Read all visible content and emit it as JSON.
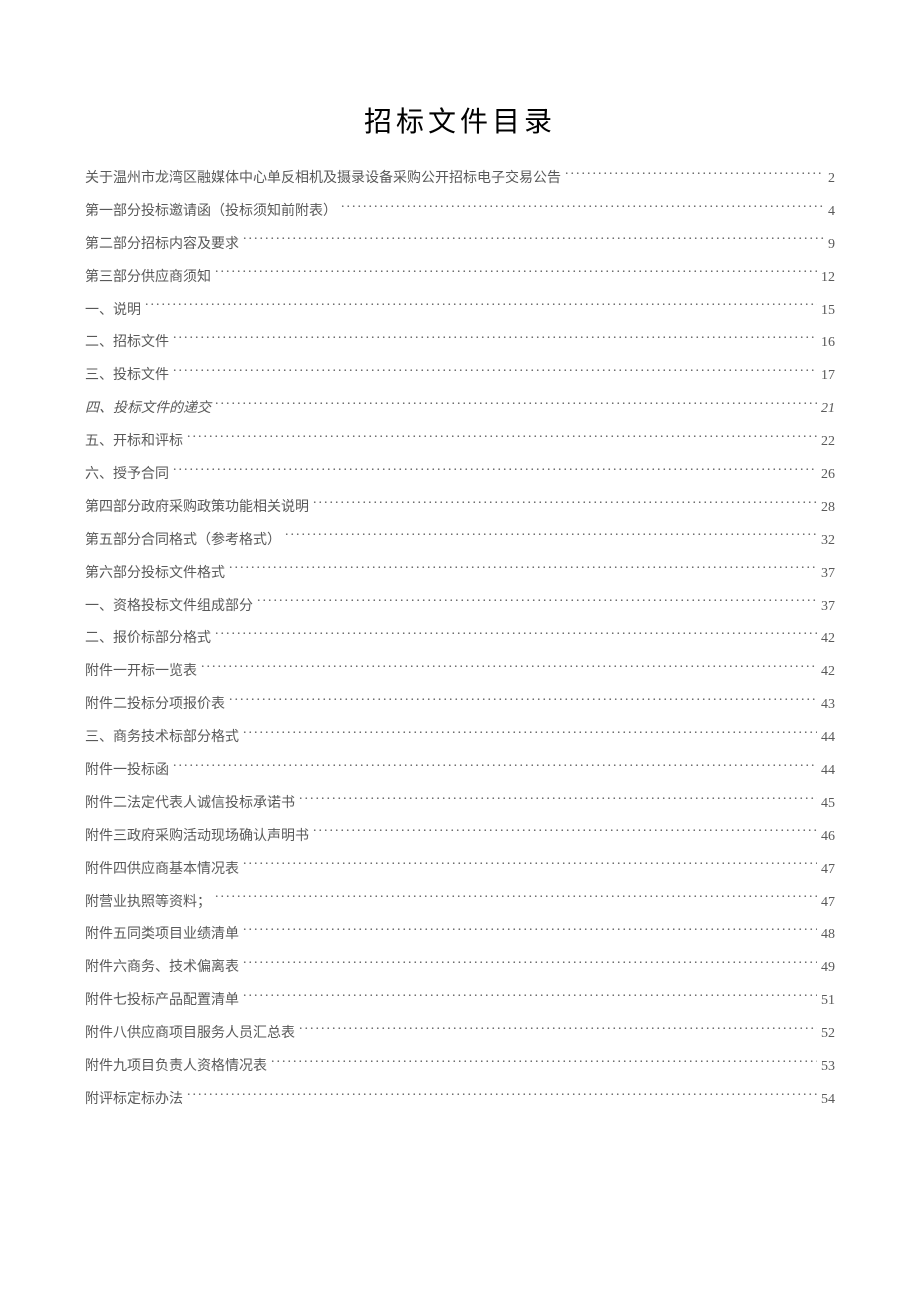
{
  "title": "招标文件目录",
  "toc": [
    {
      "label": "关于温州市龙湾区融媒体中心单反相机及摄录设备采购公开招标电子交易公告",
      "page": "2",
      "italic": false
    },
    {
      "label": "第一部分投标邀请函（投标须知前附表）",
      "page": "4",
      "italic": false
    },
    {
      "label": "第二部分招标内容及要求",
      "page": "9",
      "italic": false
    },
    {
      "label": "第三部分供应商须知",
      "page": "12",
      "italic": false
    },
    {
      "label": "一、说明",
      "page": "15",
      "italic": false
    },
    {
      "label": "二、招标文件",
      "page": "16",
      "italic": false
    },
    {
      "label": "三、投标文件",
      "page": "17",
      "italic": false
    },
    {
      "label": "四、投标文件的递交",
      "page": "21",
      "italic": true
    },
    {
      "label": "五、开标和评标",
      "page": "22",
      "italic": false
    },
    {
      "label": "六、授予合同",
      "page": "26",
      "italic": false
    },
    {
      "label": "第四部分政府采购政策功能相关说明",
      "page": "28",
      "italic": false
    },
    {
      "label": "第五部分合同格式（参考格式）",
      "page": "32",
      "italic": false
    },
    {
      "label": "第六部分投标文件格式",
      "page": "37",
      "italic": false
    },
    {
      "label": "一、资格投标文件组成部分",
      "page": "37",
      "italic": false
    },
    {
      "label": "二、报价标部分格式",
      "page": "42",
      "italic": false
    },
    {
      "label": "附件一开标一览表",
      "page": "42",
      "italic": false
    },
    {
      "label": "附件二投标分项报价表",
      "page": "43",
      "italic": false
    },
    {
      "label": "三、商务技术标部分格式",
      "page": "44",
      "italic": false
    },
    {
      "label": "附件一投标函",
      "page": "44",
      "italic": false
    },
    {
      "label": "附件二法定代表人诚信投标承诺书",
      "page": "45",
      "italic": false
    },
    {
      "label": "附件三政府采购活动现场确认声明书",
      "page": "46",
      "italic": false
    },
    {
      "label": "附件四供应商基本情况表",
      "page": "47",
      "italic": false
    },
    {
      "label": "附营业执照等资料；",
      "page": "47",
      "italic": false
    },
    {
      "label": "附件五同类项目业绩清单",
      "page": "48",
      "italic": false
    },
    {
      "label": "附件六商务、技术偏离表",
      "page": "49",
      "italic": false
    },
    {
      "label": "附件七投标产品配置清单",
      "page": "51",
      "italic": false
    },
    {
      "label": "附件八供应商项目服务人员汇总表",
      "page": "52",
      "italic": false
    },
    {
      "label": "附件九项目负责人资格情况表",
      "page": "53",
      "italic": false
    },
    {
      "label": "附评标定标办法",
      "page": "54",
      "italic": false
    }
  ]
}
